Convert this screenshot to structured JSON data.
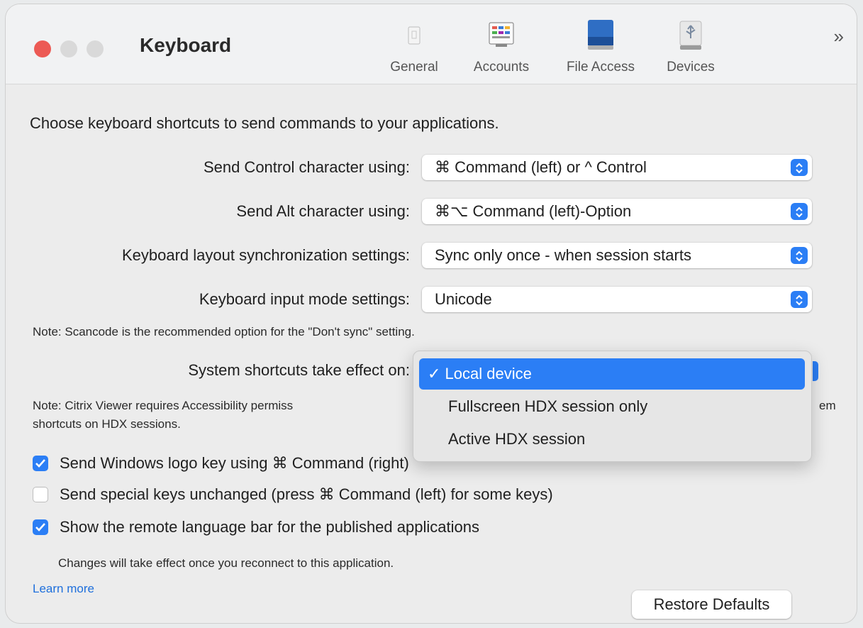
{
  "window": {
    "title": "Keyboard"
  },
  "toolbar": {
    "tabs": [
      {
        "label": "General",
        "icon": "general-icon"
      },
      {
        "label": "Accounts",
        "icon": "accounts-icon"
      },
      {
        "label": "File Access",
        "icon": "file-access-icon"
      },
      {
        "label": "Devices",
        "icon": "devices-icon"
      }
    ],
    "more": "»"
  },
  "intro": "Choose keyboard shortcuts to send commands to your applications.",
  "settings": {
    "control_char": {
      "label": "Send Control character using:",
      "value": "⌘ Command (left) or ^ Control"
    },
    "alt_char": {
      "label": "Send Alt character using:",
      "value": "⌘⌥ Command (left)-Option"
    },
    "layout_sync": {
      "label": "Keyboard layout synchronization settings:",
      "value": "Sync only once - when session starts"
    },
    "input_mode": {
      "label": "Keyboard input mode settings:",
      "value": "Unicode"
    },
    "input_note": "Note: Scancode is the recommended option for the \"Don't sync\" setting.",
    "system_shortcuts": {
      "label": "System shortcuts take effect on:"
    },
    "access_note_1": "Note: Citrix Viewer requires Accessibility permiss",
    "access_note_1b": "em",
    "access_note_2": "shortcuts on HDX sessions."
  },
  "dropdown": {
    "options": [
      {
        "label": "✓ Local device",
        "selected": true
      },
      {
        "label": "Fullscreen HDX session only",
        "selected": false
      },
      {
        "label": "Active HDX session",
        "selected": false
      }
    ]
  },
  "checkboxes": [
    {
      "label": "Send Windows logo key using ⌘ Command (right)",
      "checked": true
    },
    {
      "label": "Send special keys unchanged (press ⌘ Command (left) for some keys)",
      "checked": false
    },
    {
      "label": "Show the remote language bar for the published applications",
      "checked": true
    }
  ],
  "changes_note": "Changes will take effect once you reconnect to this application.",
  "learn_more": "Learn more",
  "restore_button": "Restore Defaults",
  "colors": {
    "accent": "#2b7ef5",
    "close": "#ec5a54",
    "link": "#1e6fdc"
  }
}
